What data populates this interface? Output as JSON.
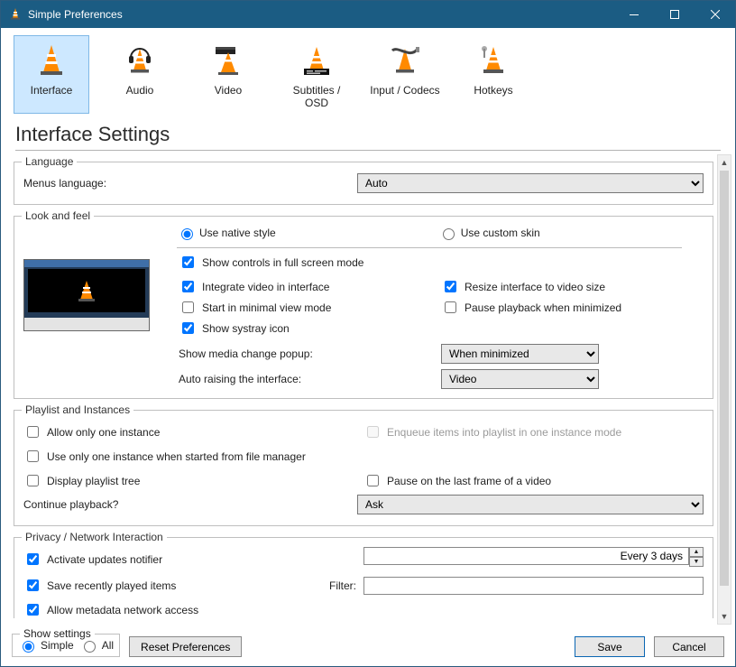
{
  "titlebar": {
    "title": "Simple Preferences"
  },
  "tabs": [
    {
      "label": "Interface",
      "selected": true
    },
    {
      "label": "Audio",
      "selected": false
    },
    {
      "label": "Video",
      "selected": false
    },
    {
      "label": "Subtitles / OSD",
      "selected": false
    },
    {
      "label": "Input / Codecs",
      "selected": false
    },
    {
      "label": "Hotkeys",
      "selected": false
    }
  ],
  "heading": "Interface Settings",
  "language_group": {
    "legend": "Language",
    "menus_language_label": "Menus language:",
    "menus_language_value": "Auto"
  },
  "lookfeel_group": {
    "legend": "Look and feel",
    "native_style_label": "Use native style",
    "custom_skin_label": "Use custom skin",
    "style_selected": "native",
    "chk_show_controls": "Show controls in full screen mode",
    "chk_integrate_video": "Integrate video in interface",
    "chk_start_minimal": "Start in minimal view mode",
    "chk_show_systray": "Show systray icon",
    "chk_resize_iface": "Resize interface to video size",
    "chk_pause_minimized": "Pause playback when minimized",
    "vals": {
      "show_controls": true,
      "integrate_video": true,
      "start_minimal": false,
      "show_systray": true,
      "resize_iface": true,
      "pause_minimized": false
    },
    "media_change_label": "Show media change popup:",
    "media_change_value": "When minimized",
    "auto_raise_label": "Auto raising the interface:",
    "auto_raise_value": "Video"
  },
  "playlist_group": {
    "legend": "Playlist and Instances",
    "chk_one_instance": "Allow only one instance",
    "chk_enqueue_one_instance": "Enqueue items into playlist in one instance mode",
    "chk_one_instance_fm": "Use only one instance when started from file manager",
    "chk_display_tree": "Display playlist tree",
    "chk_pause_last_frame": "Pause on the last frame of a video",
    "vals": {
      "one_instance": false,
      "enqueue_one_instance": false,
      "one_instance_fm": false,
      "display_tree": false,
      "pause_last_frame": false
    },
    "continue_label": "Continue playback?",
    "continue_value": "Ask"
  },
  "privacy_group": {
    "legend": "Privacy / Network Interaction",
    "chk_updates": "Activate updates notifier",
    "chk_recent": "Save recently played items",
    "chk_metadata": "Allow metadata network access",
    "vals": {
      "updates": true,
      "recent": true,
      "metadata": true
    },
    "update_interval_value": "Every 3 days",
    "filter_label": "Filter:",
    "filter_value": ""
  },
  "footer": {
    "show_settings_legend": "Show settings",
    "simple_label": "Simple",
    "all_label": "All",
    "show_settings_value": "simple",
    "reset_label": "Reset Preferences",
    "save_label": "Save",
    "cancel_label": "Cancel"
  }
}
